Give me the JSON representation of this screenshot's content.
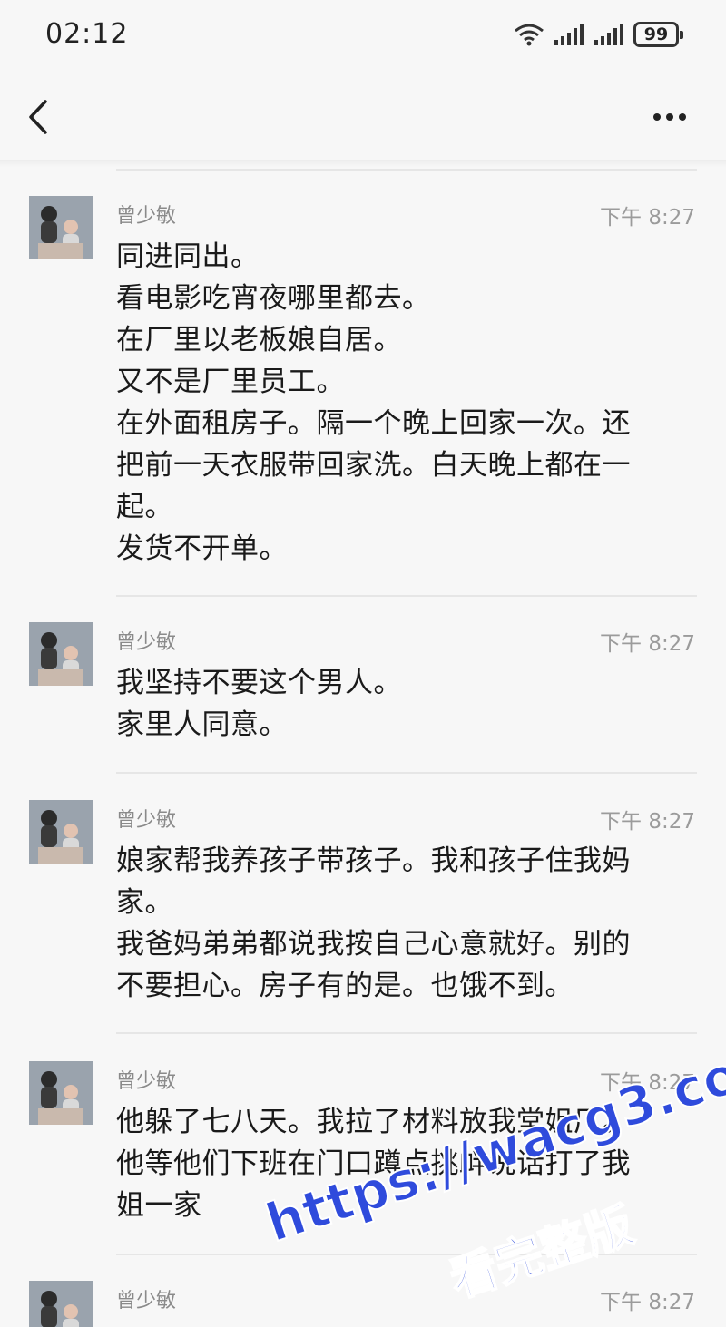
{
  "status": {
    "time": "02:12",
    "battery": "99"
  },
  "messages": [
    {
      "sender": "曾少敏",
      "time": "下午 8:27",
      "lines": [
        "同进同出。",
        "看电影吃宵夜哪里都去。",
        "在厂里以老板娘自居。",
        "又不是厂里员工。",
        "在外面租房子。隔一个晚上回家一次。还",
        "把前一天衣服带回家洗。白天晚上都在一",
        "起。",
        "发货不开单。"
      ]
    },
    {
      "sender": "曾少敏",
      "time": "下午 8:27",
      "lines": [
        "我坚持不要这个男人。",
        "家里人同意。"
      ]
    },
    {
      "sender": "曾少敏",
      "time": "下午 8:27",
      "lines": [
        "娘家帮我养孩子带孩子。我和孩子住我妈",
        "家。",
        "我爸妈弟弟都说我按自己心意就好。别的",
        "不要担心。房子有的是。也饿不到。"
      ]
    },
    {
      "sender": "曾少敏",
      "time": "下午 8:27",
      "lines": [
        "他躲了七八天。我拉了材料放我堂姐厂。",
        "他等他们下班在门口蹲点挑衅说话打了我",
        "姐一家"
      ]
    },
    {
      "sender": "曾少敏",
      "time": "下午 8:27",
      "lines": []
    }
  ],
  "watermark": {
    "url": "https://wacg3.com",
    "caption": "看完整版"
  }
}
